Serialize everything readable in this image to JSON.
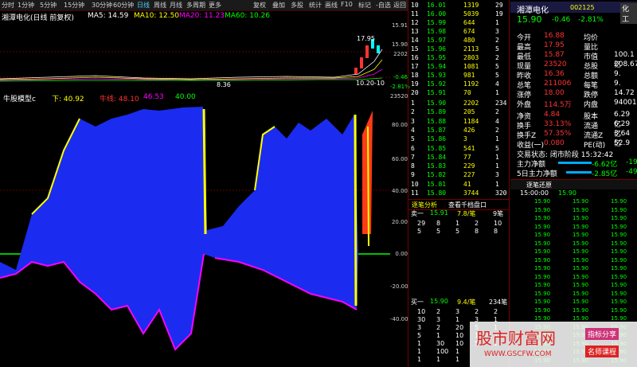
{
  "toolbar": {
    "items": [
      "分时",
      "1分钟",
      "5分钟",
      "15分钟",
      "30分钟",
      "60分钟",
      "日线",
      "周线",
      "月线",
      "多周期",
      "更多",
      "复权",
      "叠加",
      "多股",
      "统计",
      "画线",
      "F10",
      "标记",
      "-自选",
      "返回"
    ]
  },
  "kline_info": {
    "name": "湘潭电化(日线 前复权)",
    "ma5_label": "MA5: 14.59",
    "ma10_label": "MA10: 12.50",
    "ma20_label": "MA20: 11.23",
    "ma60_label": "MA60: 10.26",
    "colors": {
      "ma5": "#ffffff",
      "ma10": "#ffff00",
      "ma20": "#ff00ff",
      "ma60": "#00ff00"
    }
  },
  "price_axis": {
    "top": "15.91",
    "mid": "15.90",
    "r1": "2202",
    "r2": "-0.46",
    "r3": "-2.81%",
    "vol": "23520"
  },
  "price_chart": {
    "high_label": "17.95",
    "low_label": "8.36",
    "date_label": "10.20-10"
  },
  "indicator": {
    "name": "牛股模型c",
    "down_label": "下: 40.92",
    "bull_label": "牛线: 48.10",
    "v3": "46.53",
    "v4": "40.00",
    "axis_ticks": [
      "80.00",
      "60.00",
      "40.00",
      "20.00",
      "0.00",
      "-20.00",
      "-40.00"
    ]
  },
  "order_book_top": [
    {
      "i": "10",
      "p": "16.01",
      "v": "1319",
      "v2": "29"
    },
    {
      "i": "11",
      "p": "16.00",
      "v": "5039",
      "v2": "19"
    },
    {
      "i": "12",
      "p": "15.99",
      "v": "644",
      "v2": "1"
    },
    {
      "i": "13",
      "p": "15.98",
      "v": "674",
      "v2": "3"
    },
    {
      "i": "14",
      "p": "15.97",
      "v": "480",
      "v2": "2"
    },
    {
      "i": "15",
      "p": "15.96",
      "v": "2113",
      "v2": "5"
    },
    {
      "i": "16",
      "p": "15.95",
      "v": "2803",
      "v2": "2"
    },
    {
      "i": "17",
      "p": "15.94",
      "v": "1081",
      "v2": "5"
    },
    {
      "i": "18",
      "p": "15.93",
      "v": "981",
      "v2": "5"
    },
    {
      "i": "19",
      "p": "15.92",
      "v": "1192",
      "v2": "4"
    },
    {
      "i": "20",
      "p": "15.91",
      "v": "70",
      "v2": "1"
    }
  ],
  "order_book_bottom": [
    {
      "i": "1",
      "p": "15.90",
      "v": "2202",
      "v2": "234"
    },
    {
      "i": "2",
      "p": "15.89",
      "v": "205",
      "v2": "2"
    },
    {
      "i": "3",
      "p": "15.88",
      "v": "1184",
      "v2": "4"
    },
    {
      "i": "4",
      "p": "15.87",
      "v": "426",
      "v2": "2"
    },
    {
      "i": "5",
      "p": "15.86",
      "v": "3",
      "v2": "1"
    },
    {
      "i": "6",
      "p": "15.85",
      "v": "541",
      "v2": "5"
    },
    {
      "i": "7",
      "p": "15.84",
      "v": "77",
      "v2": "1"
    },
    {
      "i": "8",
      "p": "15.83",
      "v": "229",
      "v2": "1"
    },
    {
      "i": "9",
      "p": "15.82",
      "v": "227",
      "v2": "3"
    },
    {
      "i": "10",
      "p": "15.81",
      "v": "41",
      "v2": "1"
    },
    {
      "i": "11",
      "p": "15.80",
      "v": "3744",
      "v2": "320"
    }
  ],
  "quote": {
    "name": "湘潭电化",
    "code": "002125",
    "price": "15.90",
    "change": "-0.46",
    "pct": "-2.81%",
    "tag": "化工",
    "rows": [
      [
        "今开",
        "16.88",
        "均价",
        ""
      ],
      [
        "最高",
        "17.95",
        "量比",
        ""
      ],
      [
        "最低",
        "15.87",
        "市值",
        "100.1亿"
      ],
      [
        "现量",
        "23520",
        "总股",
        "208.67"
      ],
      [
        "昨收",
        "16.36",
        "总额",
        "9."
      ],
      [
        "总笔",
        "211006",
        "每笔",
        "9."
      ],
      [
        "涨停",
        "18.00",
        "跌停",
        "14.72"
      ],
      [
        "外盘",
        "114.5万",
        "内盘",
        "94001"
      ]
    ],
    "rows2": [
      [
        "净资",
        "4.84",
        "股本",
        "6.29亿"
      ],
      [
        "换手",
        "33.13%",
        "流通",
        "6.29亿"
      ],
      [
        "换手Z",
        "57.35%",
        "流通Z",
        "3.64亿"
      ],
      [
        "收益(一)",
        "0.080",
        "PE(动)",
        "52.9"
      ]
    ],
    "trade_state": "交易状态: 闭市阶段 15:32:42",
    "main_flow": "主力净额",
    "main_flow_val": "-6.62亿",
    "main_flow_val2": "-19",
    "flow5": "5日主力净额",
    "flow5_val": "-2.85亿",
    "flow5_val2": "-49"
  },
  "panel_tabs": {
    "tab1": "逐笔分析",
    "tab2": "查看千档盘口",
    "tab3": "逐笔还原"
  },
  "sell_one": {
    "label": "卖一",
    "price": "15.91",
    "qty": "7.8/笔",
    "count": "9笔"
  },
  "sell_grid": [
    [
      "29",
      "8",
      "1",
      "2",
      "10"
    ],
    [
      "5",
      "5",
      "5",
      "8",
      "8"
    ]
  ],
  "buy_one": {
    "label": "买一",
    "price": "15.90",
    "qty": "9.4/笔",
    "count": "234笔"
  },
  "buy_grid": [
    [
      "10",
      "2",
      "3",
      "2",
      "2"
    ],
    [
      "30",
      "3",
      "1",
      "3",
      "1"
    ],
    [
      "3",
      "2",
      "20",
      "5",
      "1"
    ],
    [
      "5",
      "1",
      "10",
      "1",
      "3"
    ],
    [
      "1",
      "30",
      "10",
      "5",
      "1"
    ],
    [
      "1",
      "100",
      "1",
      "",
      ""
    ],
    [
      "1",
      "1",
      "1",
      "",
      ""
    ]
  ],
  "tick_list": {
    "time": "15:00:00",
    "price": "15.90",
    "rows": [
      "15.90",
      "15.90",
      "15.90",
      "15.90",
      "15.90",
      "15.90",
      "15.90",
      "15.90",
      "15.90",
      "15.90",
      "15.90",
      "15.90",
      "15.90",
      "15.90",
      "15.90",
      "15.90",
      "15.90",
      "15.90",
      "15.90",
      "15.90"
    ]
  },
  "watermark": {
    "site": "股市财富网",
    "url": "WWW.GSCFW.COM",
    "badge1": "指标分享",
    "badge2": "名师课程"
  }
}
